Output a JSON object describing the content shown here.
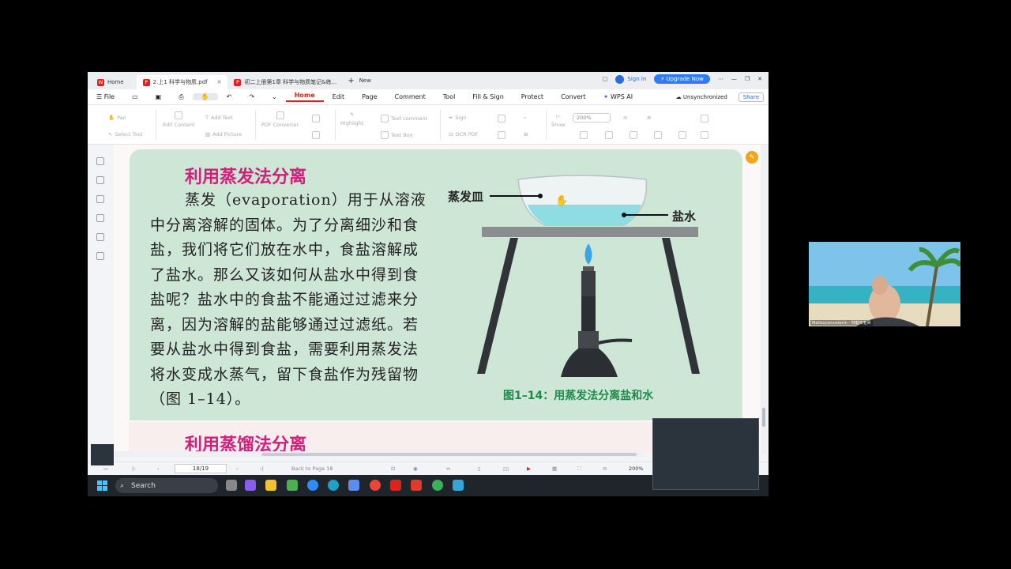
{
  "tabs": [
    {
      "label": "Home",
      "active": false
    },
    {
      "label": "2.上1 科学与物质.pdf",
      "active": true
    },
    {
      "label": "初二上册第1章 科学与物质笔记&练...",
      "active": false
    }
  ],
  "new_tab_label": "New",
  "titlebar": {
    "sign_in": "Sign in",
    "upgrade": "Upgrade Now"
  },
  "menu": {
    "file": "File",
    "items": [
      "Home",
      "Edit",
      "Page",
      "Comment",
      "Tool",
      "Fill & Sign",
      "Protect",
      "Convert",
      "WPS AI"
    ],
    "active": "Home",
    "sync": "Unsynchronized",
    "share": "Share"
  },
  "ribbon": {
    "pan": "Pan",
    "select_tool": "Select Tool",
    "edit_content": "Edit Content",
    "add_text": "Add Text",
    "add_picture": "Add Picture",
    "pdf_converter": "PDF Converter",
    "highlight": "Highlight",
    "text_comment": "Text comment",
    "text_box": "Text Box",
    "sign": "Sign",
    "ocr_pdf": "OCR PDF",
    "show": "Show",
    "zoom": "200%"
  },
  "document": {
    "heading1": "利用蒸发法分离",
    "paragraph": "蒸发（evaporation）用于从溶液中分离溶解的固体。为了分离细沙和食盐，我们将它们放在水中，食盐溶解成了盐水。那么又该如何从盐水中得到食盐呢？盐水中的食盐不能通过过滤来分离，因为溶解的盐能够通过过滤纸。若要从盐水中得到食盐，需要利用蒸发法将水变成水蒸气，留下食盐作为残留物（图 1–14）。",
    "label_dish": "蒸发皿",
    "label_saltwater": "盐水",
    "caption": "图1–14：用蒸发法分离盐和水",
    "heading2": "利用蒸馏法分离"
  },
  "statusbar": {
    "page": "18/19",
    "back": "Back to Page 18",
    "zoom": "200%"
  },
  "taskbar": {
    "search": "Search"
  },
  "webcam": {
    "name": "Mattsscienceterm - 林健双老师"
  },
  "colors": {
    "accent": "#d9251c",
    "heading": "#d0207a",
    "caption": "#1f8a4c",
    "panel": "#cde6d6",
    "upgrade": "#2f7bf5"
  }
}
